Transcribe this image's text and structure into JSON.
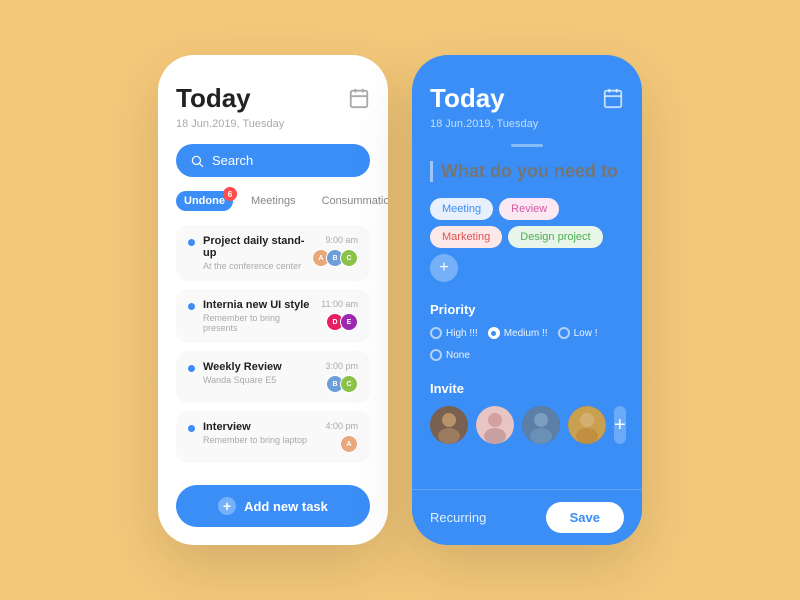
{
  "app": {
    "background": "#f5c97a"
  },
  "left_phone": {
    "title": "Today",
    "date": "18 Jun.2019, Tuesday",
    "search_placeholder": "Search",
    "tabs": [
      {
        "id": "undone",
        "label": "Undone",
        "active": true,
        "badge": "6"
      },
      {
        "id": "meetings",
        "label": "Meetings",
        "active": false
      },
      {
        "id": "consummation",
        "label": "Consummation",
        "active": false
      }
    ],
    "tasks": [
      {
        "id": 1,
        "name": "Project daily stand-up",
        "sub": "At the conference center",
        "time": "9:00 am",
        "avatars": [
          "av1",
          "av2",
          "av3"
        ]
      },
      {
        "id": 2,
        "name": "Internia new UI style",
        "sub": "Remember to bring presents",
        "time": "11:00 am",
        "avatars": [
          "av4",
          "av5"
        ]
      },
      {
        "id": 3,
        "name": "Weekly Review",
        "sub": "Wanda Square E5",
        "time": "3:00 pm",
        "avatars": [
          "av2",
          "av3"
        ]
      },
      {
        "id": 4,
        "name": "Interview",
        "sub": "Remember to bring laptop",
        "time": "4:00 pm",
        "avatars": [
          "av1"
        ]
      }
    ],
    "add_button_label": "Add new task"
  },
  "right_phone": {
    "title": "Today",
    "date": "18 Jun.2019, Tuesday",
    "input_placeholder": "What do you need to do?",
    "tags": [
      {
        "id": "meeting",
        "label": "Meeting",
        "class": "tag-meeting"
      },
      {
        "id": "review",
        "label": "Review",
        "class": "tag-review"
      },
      {
        "id": "marketing",
        "label": "Marketing",
        "class": "tag-marketing"
      },
      {
        "id": "design",
        "label": "Design project",
        "class": "tag-design"
      }
    ],
    "priority_label": "Priority",
    "priorities": [
      {
        "id": "high",
        "label": "High !!!",
        "selected": false
      },
      {
        "id": "medium",
        "label": "Medium !!",
        "selected": true
      },
      {
        "id": "low",
        "label": "Low !",
        "selected": false
      },
      {
        "id": "none",
        "label": "None",
        "selected": false
      }
    ],
    "invite_label": "Invite",
    "invite_avatars": [
      "ia1",
      "ia2",
      "ia3",
      "ia4"
    ],
    "recurring_label": "Recurring",
    "save_label": "Save"
  }
}
